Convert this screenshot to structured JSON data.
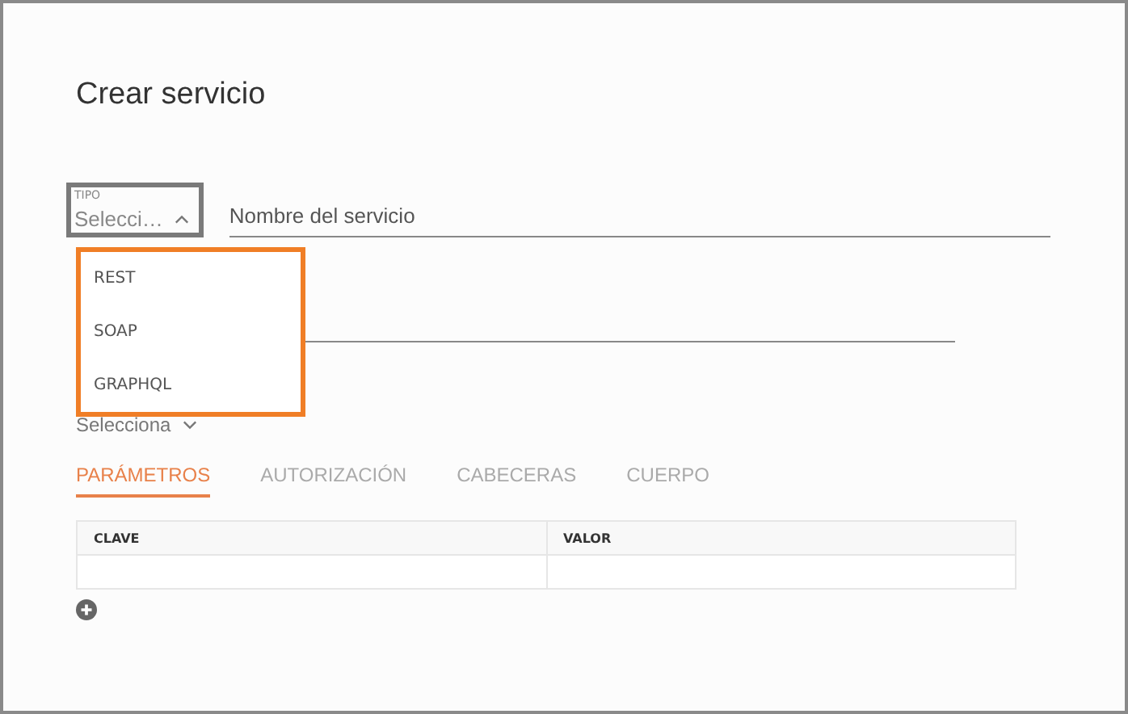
{
  "dialog": {
    "title": "Crear servicio"
  },
  "type_select": {
    "label": "TIPO",
    "value": "Selecci…",
    "open": true,
    "highlighted": true
  },
  "type_options": [
    {
      "label": "REST",
      "selected": false
    },
    {
      "label": "SOAP",
      "selected": false
    },
    {
      "label": "GRAPHQL",
      "selected": false
    }
  ],
  "name_field": {
    "placeholder": "Nombre del servicio"
  },
  "second_select": {
    "value": "Selecciona"
  },
  "tabs": [
    {
      "label": "PARÁMETROS",
      "selected": true
    },
    {
      "label": "AUTORIZACIÓN",
      "selected": false
    },
    {
      "label": "CABECERAS",
      "selected": false
    },
    {
      "label": "CUERPO",
      "selected": false
    }
  ],
  "table": {
    "columns": [
      "CLAVE",
      "VALOR"
    ]
  }
}
